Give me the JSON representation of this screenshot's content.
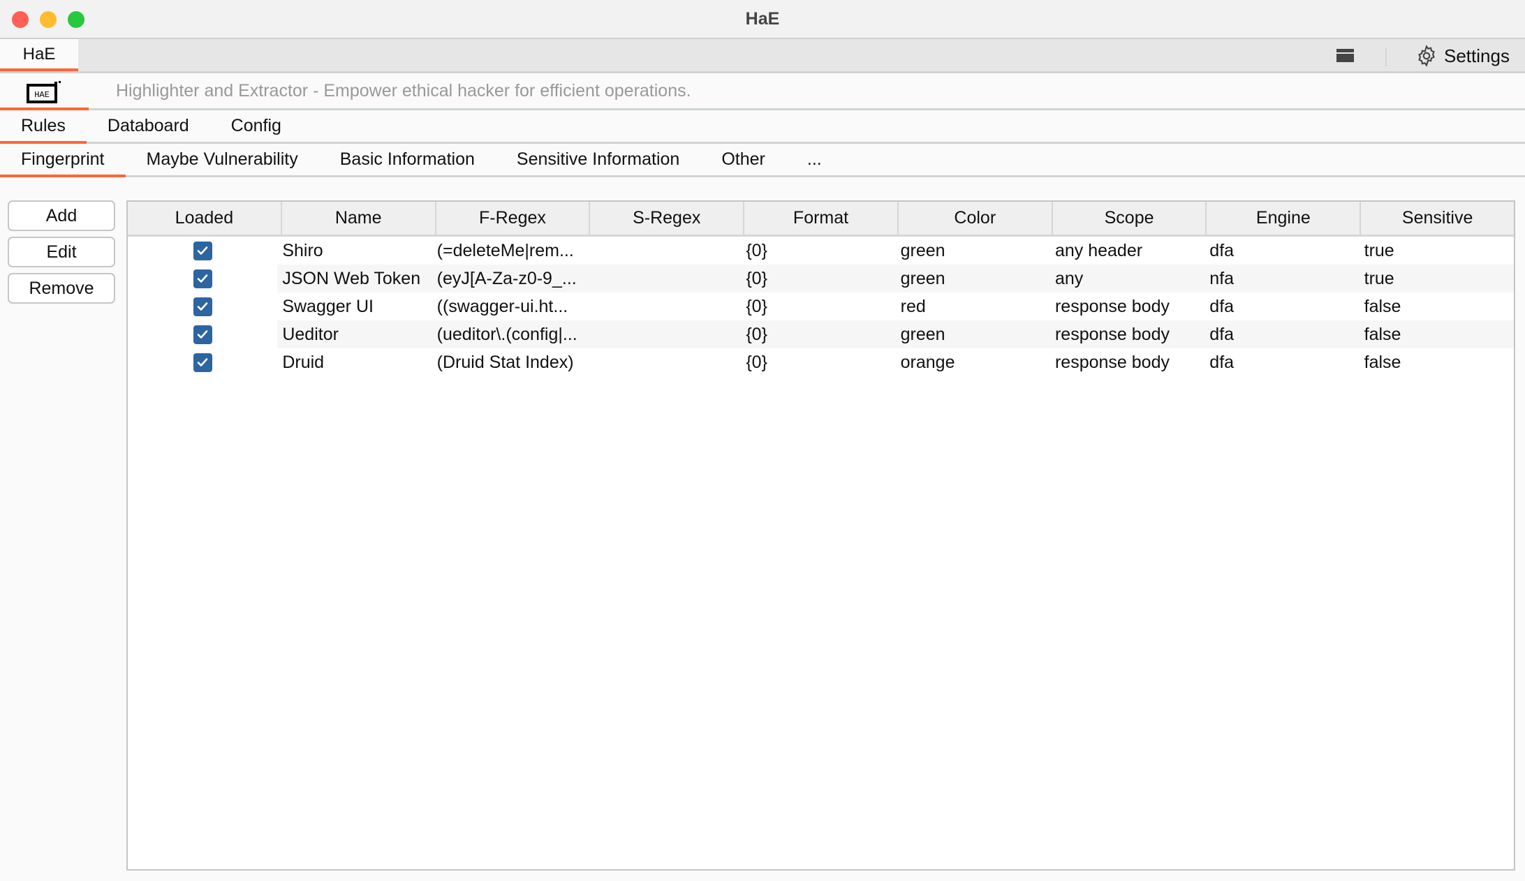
{
  "window": {
    "title": "HaE"
  },
  "top_tab": {
    "label": "HaE"
  },
  "toolbar": {
    "settings_label": "Settings"
  },
  "header": {
    "logo_text": "HaE",
    "description": "Highlighter and Extractor - Empower ethical hacker for efficient operations."
  },
  "main_tabs": [
    {
      "label": "Rules"
    },
    {
      "label": "Databoard"
    },
    {
      "label": "Config"
    }
  ],
  "category_tabs": [
    {
      "label": "Fingerprint"
    },
    {
      "label": "Maybe Vulnerability"
    },
    {
      "label": "Basic Information"
    },
    {
      "label": "Sensitive Information"
    },
    {
      "label": "Other"
    },
    {
      "label": "..."
    }
  ],
  "buttons": {
    "add": "Add",
    "edit": "Edit",
    "remove": "Remove"
  },
  "table": {
    "columns": [
      "Loaded",
      "Name",
      "F-Regex",
      "S-Regex",
      "Format",
      "Color",
      "Scope",
      "Engine",
      "Sensitive"
    ],
    "rows": [
      {
        "loaded": true,
        "name": "Shiro",
        "f_regex": "(=deleteMe|rem...",
        "s_regex": "",
        "format": "{0}",
        "color": "green",
        "scope": "any header",
        "engine": "dfa",
        "sensitive": "true"
      },
      {
        "loaded": true,
        "name": "JSON Web Token",
        "f_regex": "(eyJ[A-Za-z0-9_...",
        "s_regex": "",
        "format": "{0}",
        "color": "green",
        "scope": "any",
        "engine": "nfa",
        "sensitive": "true"
      },
      {
        "loaded": true,
        "name": "Swagger UI",
        "f_regex": "((swagger-ui.ht...",
        "s_regex": "",
        "format": "{0}",
        "color": "red",
        "scope": "response body",
        "engine": "dfa",
        "sensitive": "false"
      },
      {
        "loaded": true,
        "name": "Ueditor",
        "f_regex": "(ueditor\\.(config|...",
        "s_regex": "",
        "format": "{0}",
        "color": "green",
        "scope": "response body",
        "engine": "dfa",
        "sensitive": "false"
      },
      {
        "loaded": true,
        "name": "Druid",
        "f_regex": "(Druid Stat Index)",
        "s_regex": "",
        "format": "{0}",
        "color": "orange",
        "scope": "response body",
        "engine": "dfa",
        "sensitive": "false"
      }
    ]
  },
  "colors": {
    "accent": "#ff6633",
    "checkbox": "#2c65a1"
  }
}
